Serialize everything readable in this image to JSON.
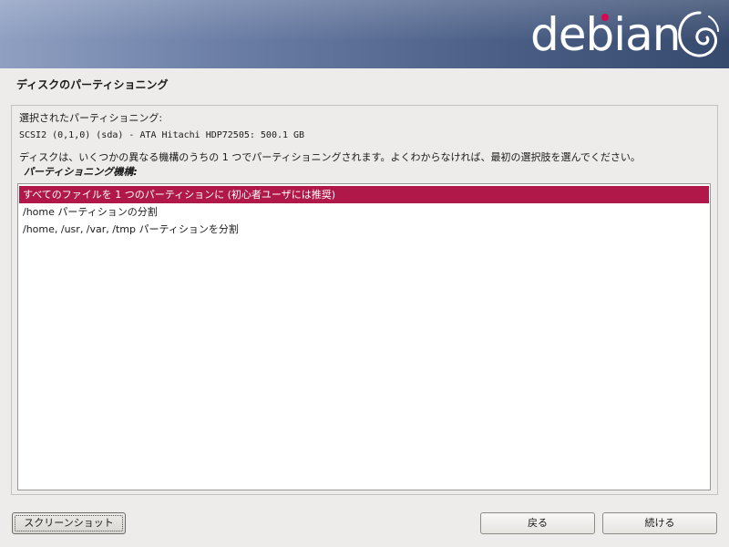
{
  "banner": {
    "logo_text": "debian",
    "accent_color": "#d70751"
  },
  "page": {
    "title": "ディスクのパーティショニング"
  },
  "content": {
    "selected_label": "選択されたパーティショニング:",
    "disk_info": "SCSI2 (0,1,0) (sda) - ATA Hitachi HDP72505: 500.1 GB",
    "description": "ディスクは、いくつかの異なる機構のうちの 1 つでパーティショニングされます。よくわからなければ、最初の選択肢を選んでください。",
    "method_label": "パーティショニング機構:"
  },
  "options": [
    {
      "label": "すべてのファイルを 1 つのパーティションに (初心者ユーザには推奨)",
      "selected": true
    },
    {
      "label": "/home パーティションの分割",
      "selected": false
    },
    {
      "label": "/home, /usr, /var, /tmp パーティションを分割",
      "selected": false
    }
  ],
  "buttons": {
    "screenshot": "スクリーンショット",
    "back": "戻る",
    "continue": "続ける"
  }
}
